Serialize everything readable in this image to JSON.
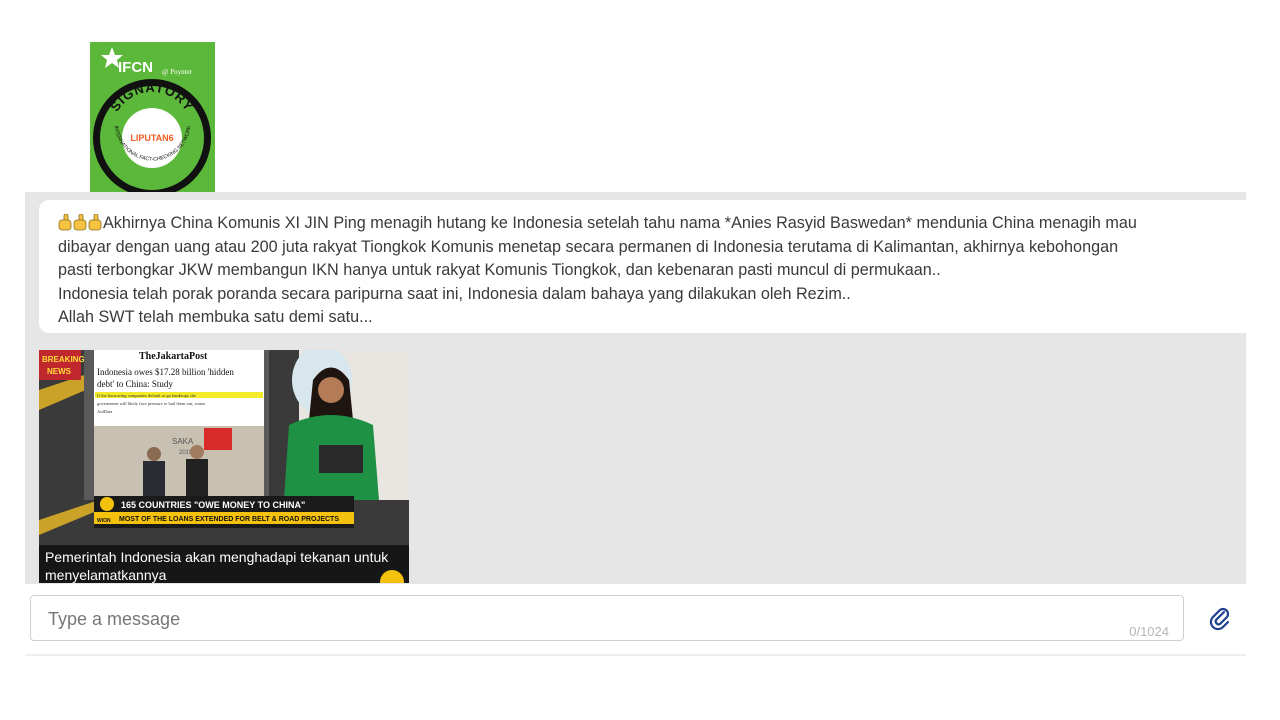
{
  "badge": {
    "brand": "IFCN",
    "partner": "Poynter",
    "signatory": "SIGNATORY",
    "ring_text": "INTERNATIONAL FACT-CHECKING NETWORK",
    "member": "LIPUTAN6",
    "colors": {
      "green": "#5cb83a",
      "ring": "#111111",
      "member_red": "#f25c24"
    }
  },
  "message": {
    "lines": [
      "Akhirnya China Komunis XI JIN Ping menagih hutang ke Indonesia setelah tahu nama *Anies Rasyid Baswedan* mendunia China menagih mau",
      "dibayar dengan uang atau 200 juta rakyat Tiongkok Komunis menetap secara permanen di Indonesia terutama di Kalimantan, akhirnya kebohongan",
      "pasti terbongkar JKW membangun IKN hanya untuk rakyat Komunis Tiongkok, dan kebenaran pasti muncul di permukaan..",
      "Indonesia telah porak poranda secara paripurna saat ini, Indonesia dalam bahaya yang dilakukan oleh Rezim..",
      "Allah SWT telah membuka satu demi satu..."
    ],
    "lead_emoji_icons": [
      "pointing-hand-icon",
      "pointing-hand-icon",
      "pointing-hand-icon"
    ]
  },
  "media": {
    "breaking": "BREAKING",
    "news": "NEWS",
    "paper_name": "TheJakartaPost",
    "headline_1": "Indonesia owes $17.28 billion 'hidden",
    "headline_2": "debt' to China: Study",
    "highlight_1": "If the borrowing companies default or go bankrupt, the",
    "highlight_2": "government will likely face pressure to bail them out, warns",
    "highlight_3": "AidData",
    "backdrop_text": "SAKA",
    "backdrop_year": "2019",
    "ticker_title": "165 COUNTRIES \"OWE MONEY TO CHINA\"",
    "ticker_sub": "MOST OF THE LOANS EXTENDED FOR BELT & ROAD PROJECTS",
    "channel": "WION",
    "caption": "Pemerintah Indonesia akan menghadapi tekanan untuk menyelamatkannya"
  },
  "composer": {
    "placeholder": "Type a message",
    "value": "",
    "char_count": "0/1024",
    "attach_icon": "paperclip-icon"
  }
}
